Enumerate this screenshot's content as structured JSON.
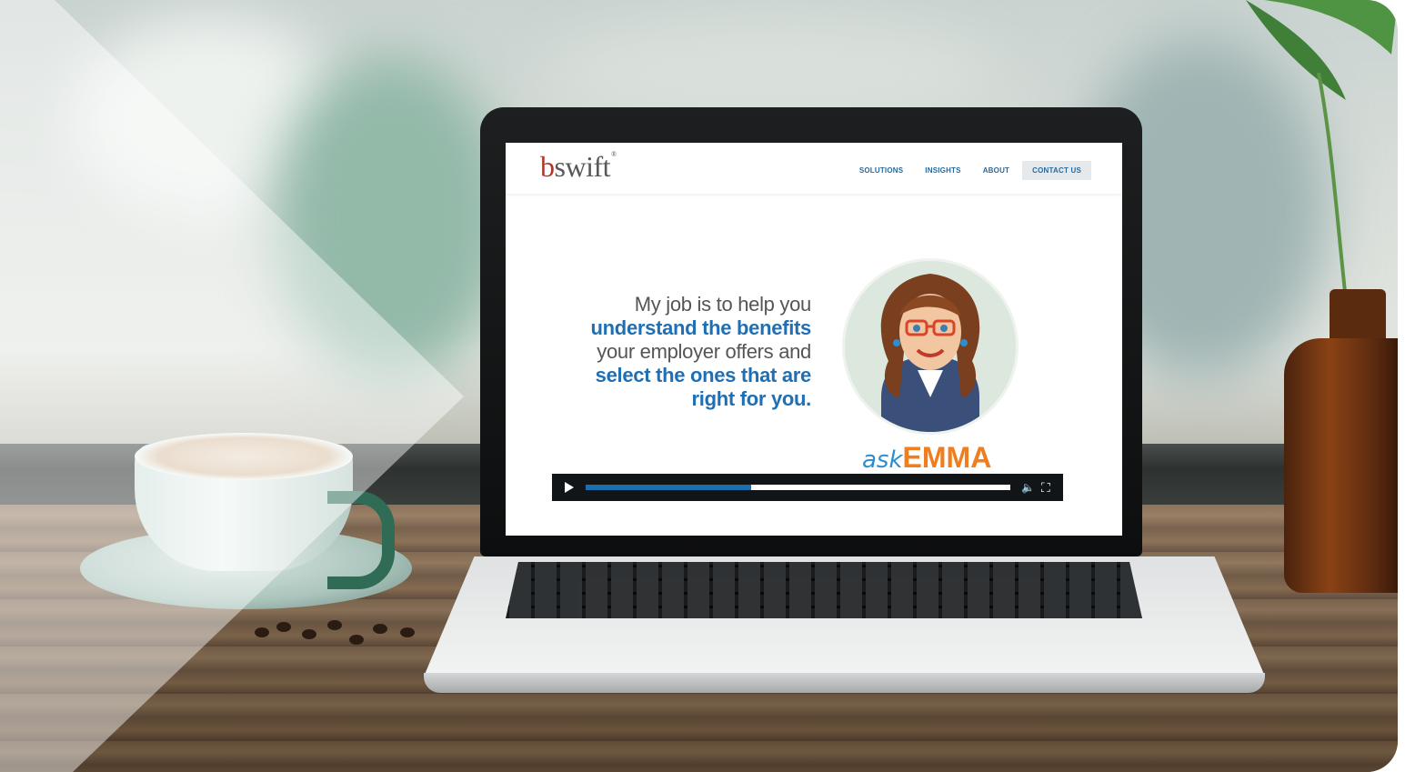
{
  "site": {
    "logo_prefix": "b",
    "logo_rest": "swift",
    "logo_mark": "®",
    "nav": {
      "solutions": "SOLUTIONS",
      "insights": "INSIGHTS",
      "about": "ABOUT",
      "contact": "CONTACT US"
    }
  },
  "hero": {
    "line1": "My job is to help you",
    "line2": "understand the benefits",
    "line3": "your employer offers and",
    "line4": "select the ones that are",
    "line5": "right for you."
  },
  "badge": {
    "ask": "ask",
    "emma": "EMMA"
  },
  "video": {
    "progress": 0.39,
    "play_icon": "play-icon",
    "volume_icon": "volume-icon",
    "fullscreen_icon": "fullscreen-icon"
  },
  "colors": {
    "brand_red": "#b0362b",
    "link_blue": "#2a6a9a",
    "headline_blue": "#1f6fb5",
    "ask_blue": "#2a8fd0",
    "emma_orange": "#f07d1e"
  }
}
